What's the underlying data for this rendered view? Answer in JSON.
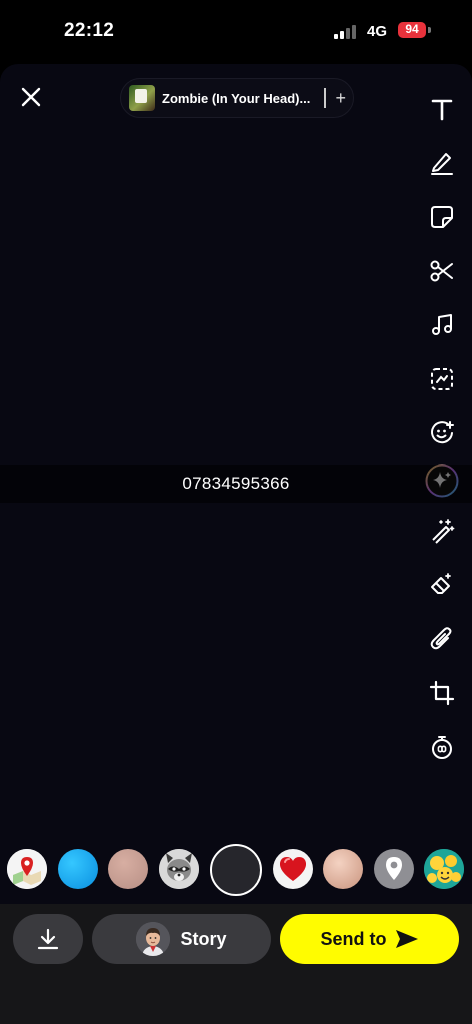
{
  "status_bar": {
    "time": "22:12",
    "network": "4G",
    "battery": "94"
  },
  "top": {
    "music_title": "Zombie (In Your Head)...",
    "add_label": "+"
  },
  "toolbar": [
    "text-icon",
    "pen-icon",
    "sticker-icon",
    "scissors-icon",
    "music-icon",
    "lens-icon",
    "emoji-icon",
    "ai-sparkle-icon",
    "magic-wand-icon",
    "eraser-icon",
    "attachment-icon",
    "crop-icon",
    "timer-icon"
  ],
  "caption": {
    "text": "07834595366"
  },
  "lenses": [
    "map-lens",
    "blue-lens",
    "pink-lens",
    "raccoon-lens",
    "capture",
    "heart-lens",
    "peach-lens",
    "location-lens",
    "emoji-lens"
  ],
  "actions": {
    "story_label": "Story",
    "send_label": "Send to"
  },
  "colors": {
    "send_button": "#fffc00",
    "canvas": "#080812",
    "bar": "#161618"
  }
}
